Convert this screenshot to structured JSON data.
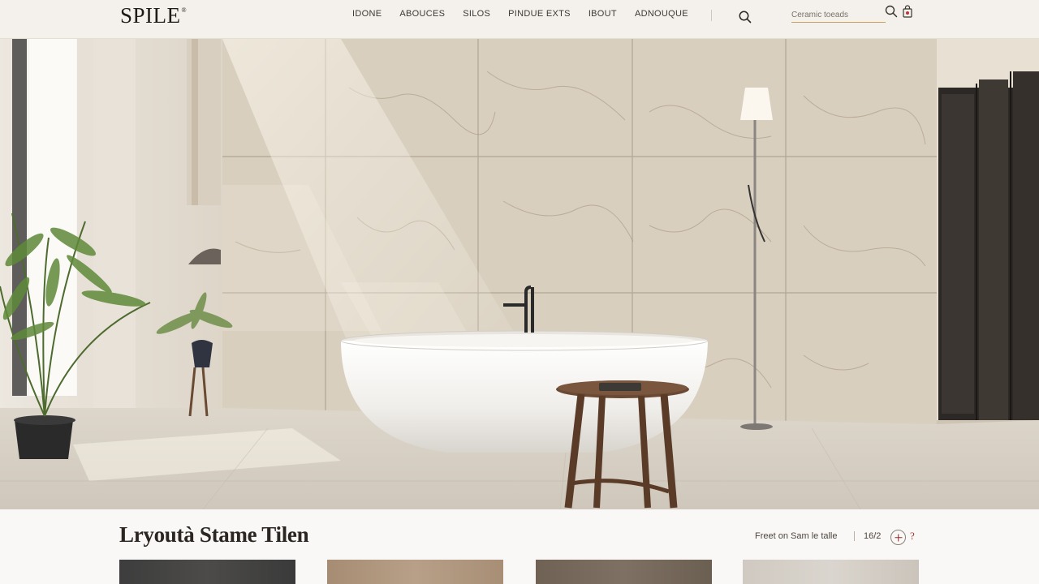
{
  "header": {
    "logo": "SPILE",
    "logo_mark": "®",
    "nav": [
      {
        "label": "IDONE"
      },
      {
        "label": "ABOUCES"
      },
      {
        "label": "SILOS"
      },
      {
        "label": "PINDUE EXTS"
      },
      {
        "label": "IBOUT"
      },
      {
        "label": "ADNOUQUE"
      }
    ],
    "search": {
      "placeholder": "Ceramic toeads"
    },
    "icons": [
      "search-icon",
      "search-icon",
      "cart-icon"
    ]
  },
  "hero": {
    "scene": "bathroom-hero-image"
  },
  "section": {
    "title": "Lryoutà Stame Tilen",
    "filter_label": "Freet on Sam le talle",
    "count": "16/2",
    "help": "?"
  },
  "tiles": [
    {
      "color": "#444443"
    },
    {
      "color": "#b09880"
    },
    {
      "color": "#766a5c"
    },
    {
      "color": "#d3cdc6"
    }
  ]
}
